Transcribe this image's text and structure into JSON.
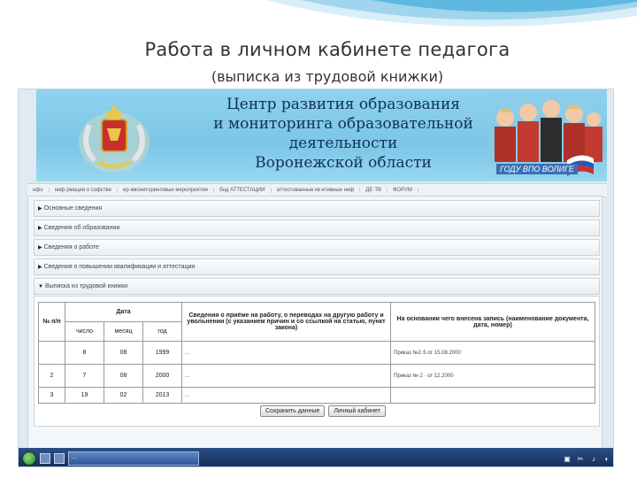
{
  "slide": {
    "title": "Работа в личном кабинете педагога",
    "subtitle": "(выписка из трудовой книжки)"
  },
  "banner": {
    "lines": [
      "Центр развития образования",
      "и мониторинга образовательной деятельности",
      "Воронежской области"
    ],
    "slogan": "ГОДУ ВПО ВОЛИГЕ"
  },
  "nav": {
    "items": [
      "нфо",
      "ниф·рмация о сэфстве",
      "ир·кмониторинговые  мероприятие",
      "бнд  АТТЕСТАЦИИ",
      "аттестованные  кв нтивные  ниф",
      "ДЕ·ТВ",
      "ФОРУМ"
    ]
  },
  "sections": [
    "Основные сведения",
    "Сведения об образовании",
    "Сведения о работе",
    "Сведения о повышении квалификации и аттестации",
    "Выписка из трудовой книжки"
  ],
  "table": {
    "headers": {
      "num": "№ п/п",
      "date": "Дата",
      "day": "число",
      "month": "месяц",
      "year": "год",
      "info": "Сведения о приёме на работу, о переводах на другую работу и увольнении (с указанием причин и со ссылкой на статью, пункт закона)",
      "basis": "На основании чего внесена запись (наименование документа, дата, номер)"
    },
    "rows": [
      {
        "num": "",
        "day": "8",
        "month": "08",
        "year": "1999",
        "info": "...",
        "basis": "Приказ №2·5 от 15.08.2000"
      },
      {
        "num": "2",
        "day": "7",
        "month": "08",
        "year": "2000",
        "info": "...",
        "basis": "Приказ № 2 · от 12.2000"
      },
      {
        "num": "3",
        "day": "19",
        "month": "02",
        "year": "2013",
        "info": "...",
        "basis": ""
      }
    ]
  },
  "buttons": {
    "save": "Сохранить данные",
    "cabinet": "Личный кабинет"
  },
  "taskbar": {
    "task": "..."
  },
  "colors": {
    "banner": "#7cc6e7",
    "taskbar": "#1e3d6d",
    "swoosh": "#5fb8e0"
  }
}
